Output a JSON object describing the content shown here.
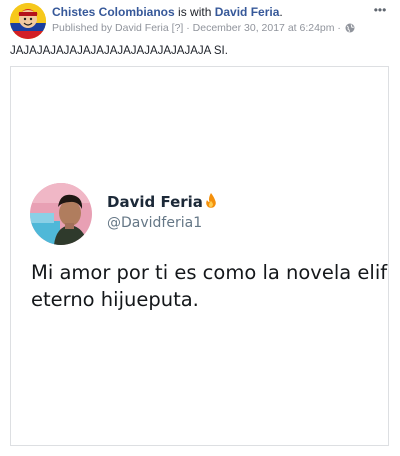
{
  "post": {
    "author": "Chistes Colombianos",
    "with_text": " is with ",
    "tagged_user": "David Feria",
    "tagged_suffix": ".",
    "published_prefix": "Published by ",
    "published_by": "David Feria",
    "unknown_marker": " [?] ",
    "date_sep": "· ",
    "date": "December 30, 2017 at 6:24pm",
    "privacy_sep": " · ",
    "privacy_icon": "globe-icon",
    "more_icon": "more-options-icon",
    "more_label": "•••",
    "message": "JAJAJAJAJAJAJAJAJAJAJAJAJAJAJA SI."
  },
  "tweet": {
    "name": "David Feria",
    "name_icon": "fire-icon",
    "handle": "@Davidferia1",
    "text_line1": "Mi amor por ti es como la novela elif,",
    "text_line2": "eterno hijueputa."
  },
  "colors": {
    "link": "#365899",
    "meta": "#90949c",
    "border": "#dddfe2",
    "tweet_text": "#14171a",
    "handle": "#657786"
  }
}
